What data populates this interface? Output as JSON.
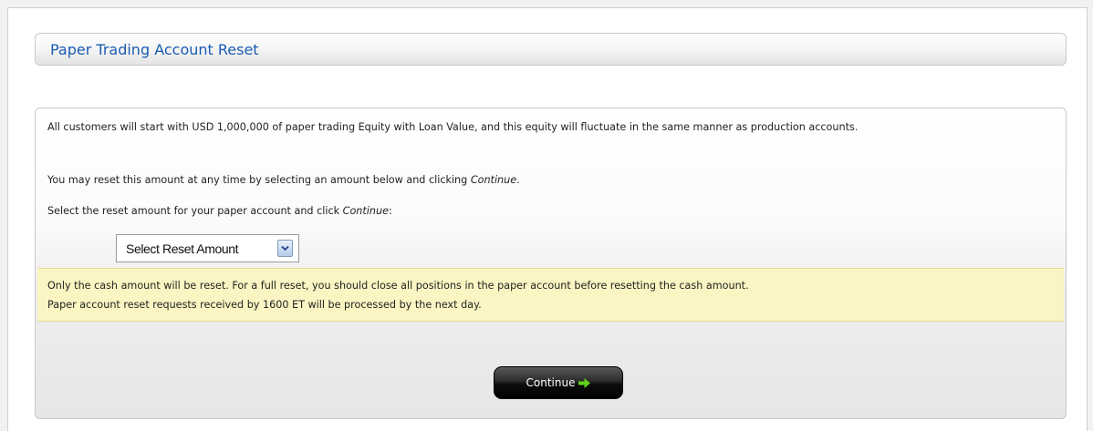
{
  "header": {
    "title": "Paper Trading Account Reset"
  },
  "content": {
    "paragraph_1": "All customers will start with USD 1,000,000 of paper trading Equity with Loan Value, and this equity will fluctuate in the same manner as production accounts.",
    "paragraph_2_prefix": "You may reset this amount at any time by selecting an amount below and clicking ",
    "paragraph_2_emphasis": "Continue",
    "paragraph_2_suffix": ".",
    "paragraph_3_prefix": "Select the reset amount for your paper account and click ",
    "paragraph_3_emphasis": "Continue",
    "paragraph_3_suffix": ":"
  },
  "reset_select": {
    "selected_value": "Select Reset Amount"
  },
  "notice": {
    "line_1": "Only the cash amount will be reset. For a full reset, you should close all positions in the paper account before resetting the cash amount.",
    "line_2": "Paper account reset requests received by 1600 ET will be processed by the next day."
  },
  "actions": {
    "continue_label": "Continue"
  },
  "icons": {
    "dropdown": "chevron-down-icon",
    "continue": "arrow-right-icon"
  },
  "colors": {
    "title": "#1a5bb3",
    "notice_background": "#faf5c2",
    "button_background": "#111111",
    "button_arrow": "#5fd11c"
  }
}
